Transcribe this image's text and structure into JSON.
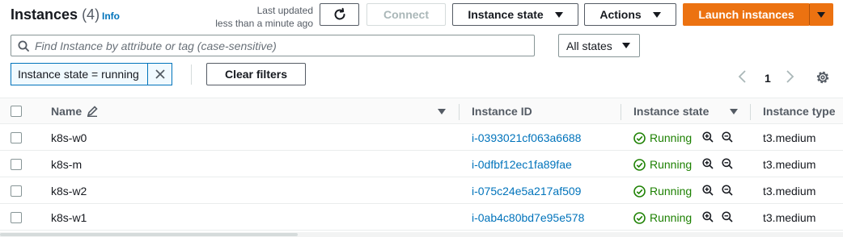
{
  "header": {
    "title": "Instances",
    "count": "(4)",
    "info_link": "Info",
    "last_updated_line1": "Last updated",
    "last_updated_line2": "less than a minute ago"
  },
  "toolbar": {
    "connect_label": "Connect",
    "instance_state_label": "Instance state",
    "actions_label": "Actions",
    "launch_label": "Launch instances"
  },
  "search": {
    "placeholder": "Find Instance by attribute or tag (case-sensitive)",
    "states_select": "All states"
  },
  "filters": {
    "token_label": "Instance state = running",
    "clear_label": "Clear filters"
  },
  "pagination": {
    "current_page": "1"
  },
  "table": {
    "columns": [
      "Name",
      "Instance ID",
      "Instance state",
      "Instance type"
    ],
    "rows": [
      {
        "name": "k8s-w0",
        "instance_id": "i-0393021cf063a6688",
        "state": "Running",
        "type": "t3.medium"
      },
      {
        "name": "k8s-m",
        "instance_id": "i-0dfbf12ec1fa89fae",
        "state": "Running",
        "type": "t3.medium"
      },
      {
        "name": "k8s-w2",
        "instance_id": "i-075c24e5a217af509",
        "state": "Running",
        "type": "t3.medium"
      },
      {
        "name": "k8s-w1",
        "instance_id": "i-0ab4c80bd7e95e578",
        "state": "Running",
        "type": "t3.medium"
      }
    ]
  },
  "colors": {
    "accent_orange": "#ec7211",
    "link_blue": "#0073bb",
    "running_green": "#1d8102"
  }
}
